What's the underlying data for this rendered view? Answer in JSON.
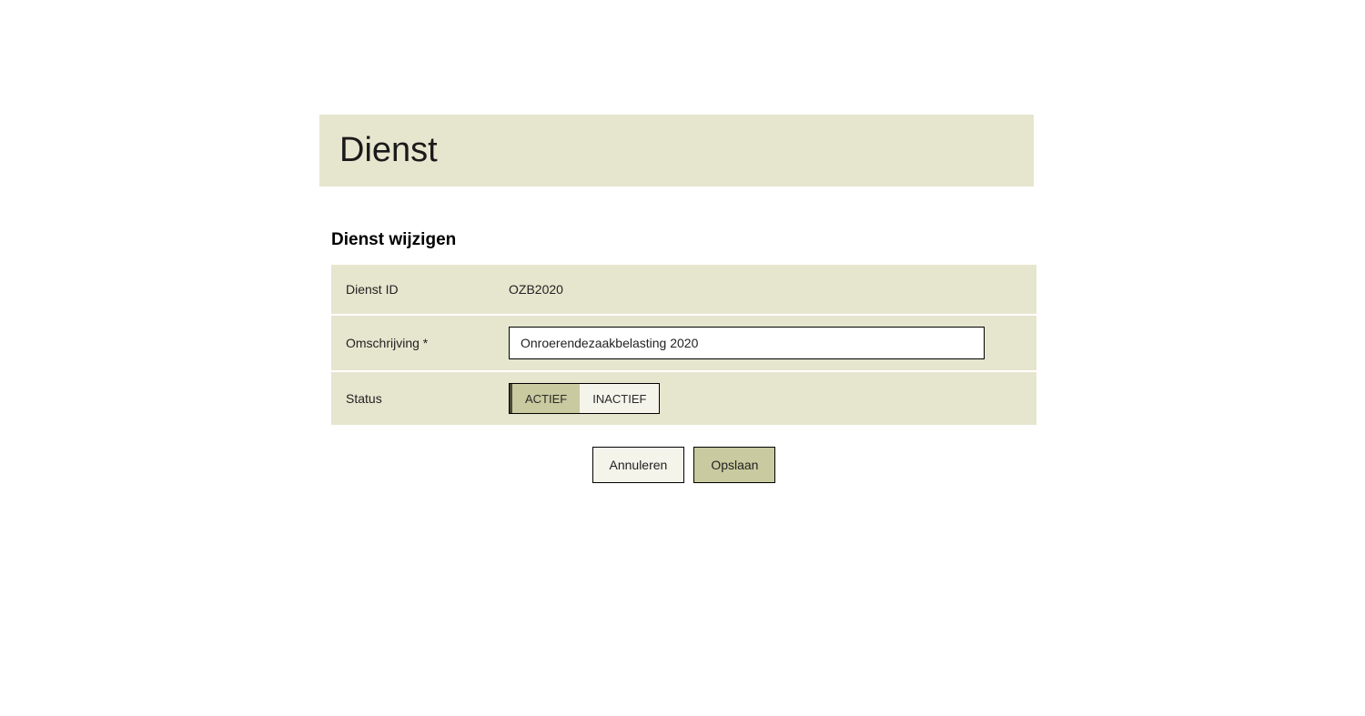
{
  "header": {
    "title": "Dienst"
  },
  "form": {
    "section_title": "Dienst wijzigen",
    "dienst_id": {
      "label": "Dienst ID",
      "value": "OZB2020"
    },
    "omschrijving": {
      "label": "Omschrijving *",
      "value": "Onroerendezaakbelasting 2020"
    },
    "status": {
      "label": "Status",
      "options": {
        "active": "ACTIEF",
        "inactive": "INACTIEF"
      },
      "selected": "active"
    }
  },
  "actions": {
    "cancel": "Annuleren",
    "save": "Opslaan"
  }
}
